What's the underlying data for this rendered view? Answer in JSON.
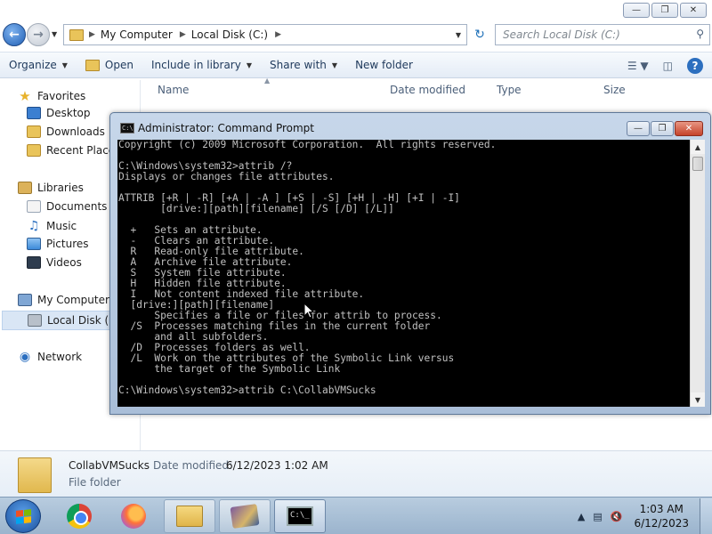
{
  "explorer": {
    "address": {
      "crumbs": [
        "My Computer",
        "Local Disk (C:)"
      ]
    },
    "search_placeholder": "Search Local Disk (C:)",
    "toolbar": {
      "organize": "Organize",
      "open": "Open",
      "include_in_library": "Include in library",
      "share_with": "Share with",
      "new_folder": "New folder"
    },
    "nav": {
      "favorites": "Favorites",
      "desktop": "Desktop",
      "downloads": "Downloads",
      "recent_places": "Recent Places",
      "libraries": "Libraries",
      "documents": "Documents",
      "music": "Music",
      "pictures": "Pictures",
      "videos": "Videos",
      "my_computer": "My Computer",
      "local_disk": "Local Disk (C:)",
      "network": "Network"
    },
    "columns": {
      "name": "Name",
      "date_modified": "Date modified",
      "type": "Type",
      "size": "Size"
    },
    "details": {
      "name": "CollabVMSucks",
      "date_label": "Date modified:",
      "date_value": "6/12/2023 1:02 AM",
      "type": "File folder"
    }
  },
  "cmd": {
    "title": "Administrator: Command Prompt",
    "lines": [
      "Copyright (c) 2009 Microsoft Corporation.  All rights reserved.",
      "",
      "C:\\Windows\\system32>attrib /?",
      "Displays or changes file attributes.",
      "",
      "ATTRIB [+R | -R] [+A | -A ] [+S | -S] [+H | -H] [+I | -I]",
      "       [drive:][path][filename] [/S [/D] [/L]]",
      "",
      "  +   Sets an attribute.",
      "  -   Clears an attribute.",
      "  R   Read-only file attribute.",
      "  A   Archive file attribute.",
      "  S   System file attribute.",
      "  H   Hidden file attribute.",
      "  I   Not content indexed file attribute.",
      "  [drive:][path][filename]",
      "      Specifies a file or files for attrib to process.",
      "  /S  Processes matching files in the current folder",
      "      and all subfolders.",
      "  /D  Processes folders as well.",
      "  /L  Work on the attributes of the Symbolic Link versus",
      "      the target of the Symbolic Link",
      "",
      "C:\\Windows\\system32>attrib C:\\CollabVMSucks"
    ]
  },
  "taskbar": {
    "clock_time": "1:03 AM",
    "clock_date": "6/12/2023",
    "apps": [
      "Google Chrome",
      "Firefox",
      "Windows Explorer",
      "WinRAR",
      "Command Prompt"
    ]
  },
  "icons": {
    "start": "windows-start-icon",
    "back": "back-arrow-icon",
    "forward": "forward-arrow-icon",
    "refresh": "refresh-icon",
    "search": "search-icon",
    "help": "help-icon"
  },
  "colors": {
    "console_bg": "#000000",
    "console_text": "#c0c0c0",
    "selection": "#d9e6f5",
    "taskbar": "#9bb4cd"
  }
}
